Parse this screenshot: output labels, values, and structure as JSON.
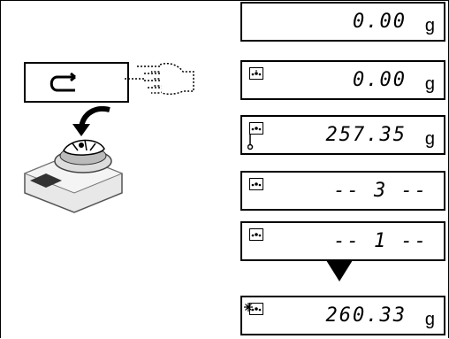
{
  "displays": [
    {
      "value": "0.00",
      "unit": "g",
      "icon": ""
    },
    {
      "value": "0.00",
      "unit": "g",
      "icon": "drops-icon"
    },
    {
      "value": "257.35",
      "unit": "g",
      "icon": "drops-icon-stable"
    },
    {
      "value": "-- 3 --",
      "unit": "",
      "icon": "drops-icon"
    },
    {
      "value": "-- 1 --",
      "unit": "",
      "icon": "drops-icon"
    },
    {
      "value": "260.33",
      "unit": "g",
      "icon": "drops-star-icon"
    }
  ],
  "colors": {
    "ink": "#000000",
    "background": "#ffffff"
  }
}
